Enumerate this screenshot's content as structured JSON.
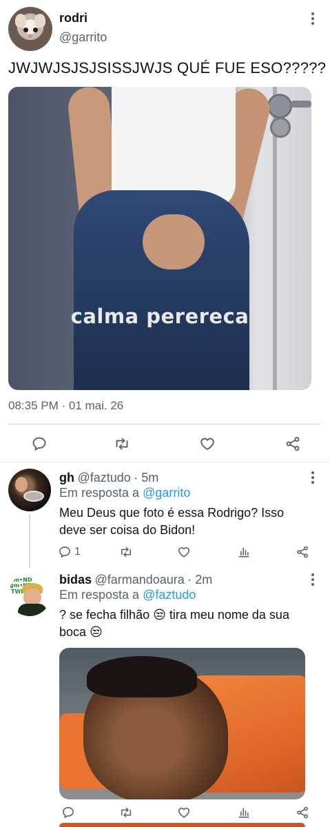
{
  "main_tweet": {
    "author_name": "rodri",
    "author_handle": "@garrito",
    "text": "JWJWJSJSJSISSJWJS QUÉ FUE ESO?????",
    "media_caption": "calma perereca",
    "timestamp": "08:35 PM · 01 mai. 26",
    "actions": [
      "reply-icon",
      "retweet-icon",
      "like-icon",
      "share-icon"
    ]
  },
  "replies": [
    {
      "author_name": "gh",
      "author_handle": "@faztudo",
      "time": "· 5m",
      "in_reply_prefix": "Em resposta a ",
      "in_reply_to": "@garrito",
      "text_line1": "Meu Deus que foto é essa Rodrigo? Isso",
      "text_line2": "deve ser coisa do Bidon!",
      "reply_count": "1"
    },
    {
      "author_name": "bidas",
      "author_handle": "@farmandoaura",
      "time": "· 2m",
      "in_reply_prefix": "Em resposta a ",
      "in_reply_to": "@faztudo",
      "text_line1": "? se fecha filhão 😒 tira meu nome da sua",
      "text_line2": "boca 😒",
      "avatar_tag_line1": "gm•ND",
      "avatar_tag_line2": "gm•ND",
      "avatar_tag_line3": "TWINK"
    }
  ],
  "colors": {
    "link": "#1d9bf0",
    "secondary_text": "#536471",
    "divider": "#cfd9de"
  }
}
